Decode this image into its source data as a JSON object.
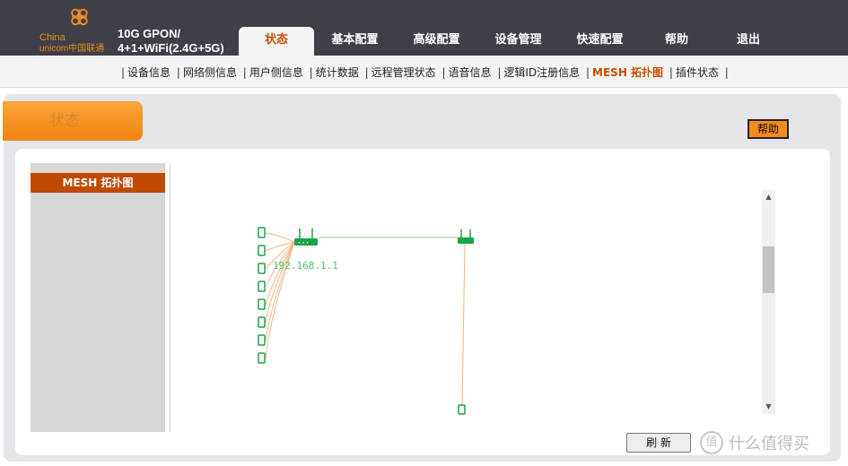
{
  "brand": {
    "logo_name_top": "China",
    "logo_name_bottom": "unicom中国联通",
    "product_line1": "10G GPON/",
    "product_line2": "4+1+WiFi(2.4G+5G)",
    "accent_color": "#f08a1e"
  },
  "nav": {
    "items": [
      {
        "label": "状态",
        "active": true
      },
      {
        "label": "基本配置",
        "active": false
      },
      {
        "label": "高级配置",
        "active": false
      },
      {
        "label": "设备管理",
        "active": false
      },
      {
        "label": "快速配置",
        "active": false
      },
      {
        "label": "帮助",
        "active": false
      },
      {
        "label": "退出",
        "active": false
      }
    ]
  },
  "subnav": {
    "items": [
      {
        "label": "设备信息",
        "active": false
      },
      {
        "label": "网络侧信息",
        "active": false
      },
      {
        "label": "用户侧信息",
        "active": false
      },
      {
        "label": "统计数据",
        "active": false
      },
      {
        "label": "远程管理状态",
        "active": false
      },
      {
        "label": "语音信息",
        "active": false
      },
      {
        "label": "逻辑ID注册信息",
        "active": false
      },
      {
        "label": "MESH 拓扑图",
        "active": true
      },
      {
        "label": "插件状态",
        "active": false
      }
    ]
  },
  "page": {
    "section_title": "状态",
    "help_label": "帮助",
    "sidebar_item": "MESH 拓扑图",
    "refresh_label": "刷 新"
  },
  "topology": {
    "main_router_ip": "192.168.1.1",
    "main_router_clients": 8,
    "satellite_clients": 1,
    "line_color_backhaul": "#a6dca6",
    "line_color_client": "#f4b27a",
    "device_color": "#1aa34a"
  },
  "watermark": {
    "icon_char": "值",
    "text": "什么值得买"
  }
}
